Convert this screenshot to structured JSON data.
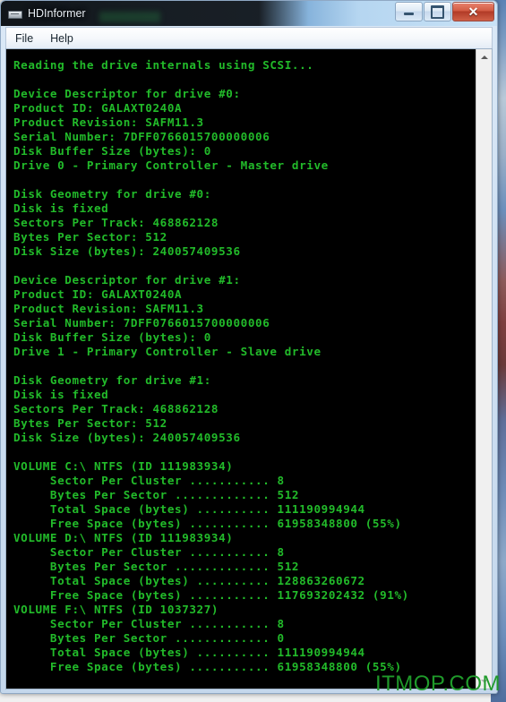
{
  "window": {
    "title": "HDInformer",
    "icon": "chip-icon",
    "controls": {
      "minimize_label": "–",
      "maximize_label": "□",
      "close_label": "✕",
      "minimize_name": "minimize",
      "maximize_name": "maximize",
      "close_name": "close"
    }
  },
  "menubar": {
    "items": [
      {
        "label": "File"
      },
      {
        "label": "Help"
      }
    ]
  },
  "scrollbar": {
    "up_arrow": "▲",
    "down_arrow": "▼"
  },
  "watermark": {
    "text": "ITMOP.COM",
    "color": "#1f9a2a"
  },
  "console": {
    "text_color": "#22bb2a",
    "background_color": "#000000",
    "content": "Reading the drive internals using SCSI...\n\nDevice Descriptor for drive #0:\nProduct ID: GALAXT0240A\nProduct Revision: SAFM11.3\nSerial Number: 7DFF0766015700000006\nDisk Buffer Size (bytes): 0\nDrive 0 - Primary Controller - Master drive\n\nDisk Geometry for drive #0:\nDisk is fixed\nSectors Per Track: 468862128\nBytes Per Sector: 512\nDisk Size (bytes): 240057409536\n\nDevice Descriptor for drive #1:\nProduct ID: GALAXT0240A\nProduct Revision: SAFM11.3\nSerial Number: 7DFF0766015700000006\nDisk Buffer Size (bytes): 0\nDrive 1 - Primary Controller - Slave drive\n\nDisk Geometry for drive #1:\nDisk is fixed\nSectors Per Track: 468862128\nBytes Per Sector: 512\nDisk Size (bytes): 240057409536\n\nVOLUME C:\\ NTFS (ID 111983934)\n     Sector Per Cluster ........... 8\n     Bytes Per Sector ............. 512\n     Total Space (bytes) .......... 111190994944\n     Free Space (bytes) ........... 61958348800 (55%)\nVOLUME D:\\ NTFS (ID 111983934)\n     Sector Per Cluster ........... 8\n     Bytes Per Sector ............. 512\n     Total Space (bytes) .......... 128863260672\n     Free Space (bytes) ........... 117693202432 (91%)\nVOLUME F:\\ NTFS (ID 1037327)\n     Sector Per Cluster ........... 8\n     Bytes Per Sector ............. 0\n     Total Space (bytes) .......... 111190994944\n     Free Space (bytes) ........... 61958348800 (55%)",
    "report": {
      "intro_line": "Reading the drive internals using SCSI...",
      "drives": [
        {
          "descriptor_header": "Device Descriptor for drive #0:",
          "product_id_label": "Product ID:",
          "product_id": "GALAXT0240A",
          "product_revision_label": "Product Revision:",
          "product_revision": "SAFM11.3",
          "serial_number_label": "Serial Number:",
          "serial_number": "7DFF0766015700000006",
          "disk_buffer_label": "Disk Buffer Size (bytes):",
          "disk_buffer": "0",
          "controller_line": "Drive 0 - Primary Controller - Master drive",
          "geometry_header": "Disk Geometry for drive #0:",
          "fixed_line": "Disk is fixed",
          "sectors_per_track_label": "Sectors Per Track:",
          "sectors_per_track": "468862128",
          "bytes_per_sector_label": "Bytes Per Sector:",
          "bytes_per_sector": "512",
          "disk_size_label": "Disk Size (bytes):",
          "disk_size": "240057409536"
        },
        {
          "descriptor_header": "Device Descriptor for drive #1:",
          "product_id_label": "Product ID:",
          "product_id": "GALAXT0240A",
          "product_revision_label": "Product Revision:",
          "product_revision": "SAFM11.3",
          "serial_number_label": "Serial Number:",
          "serial_number": "7DFF0766015700000006",
          "disk_buffer_label": "Disk Buffer Size (bytes):",
          "disk_buffer": "0",
          "controller_line": "Drive 1 - Primary Controller - Slave drive",
          "geometry_header": "Disk Geometry for drive #1:",
          "fixed_line": "Disk is fixed",
          "sectors_per_track_label": "Sectors Per Track:",
          "sectors_per_track": "468862128",
          "bytes_per_sector_label": "Bytes Per Sector:",
          "bytes_per_sector": "512",
          "disk_size_label": "Disk Size (bytes):",
          "disk_size": "240057409536"
        }
      ],
      "volumes": [
        {
          "header": "VOLUME C:\\ NTFS (ID 111983934)",
          "drive_letter": "C:\\",
          "filesystem": "NTFS",
          "id": "111983934",
          "sector_per_cluster_label": "Sector Per Cluster",
          "sector_per_cluster": "8",
          "bytes_per_sector_label": "Bytes Per Sector",
          "bytes_per_sector": "512",
          "total_space_label": "Total Space (bytes)",
          "total_space": "111190994944",
          "free_space_label": "Free Space (bytes)",
          "free_space": "61958348800",
          "free_percent": "(55%)"
        },
        {
          "header": "VOLUME D:\\ NTFS (ID 111983934)",
          "drive_letter": "D:\\",
          "filesystem": "NTFS",
          "id": "111983934",
          "sector_per_cluster_label": "Sector Per Cluster",
          "sector_per_cluster": "8",
          "bytes_per_sector_label": "Bytes Per Sector",
          "bytes_per_sector": "512",
          "total_space_label": "Total Space (bytes)",
          "total_space": "128863260672",
          "free_space_label": "Free Space (bytes)",
          "free_space": "117693202432",
          "free_percent": "(91%)"
        },
        {
          "header": "VOLUME F:\\ NTFS (ID 1037327)",
          "drive_letter": "F:\\",
          "filesystem": "NTFS",
          "id": "1037327",
          "sector_per_cluster_label": "Sector Per Cluster",
          "sector_per_cluster": "8",
          "bytes_per_sector_label": "Bytes Per Sector",
          "bytes_per_sector": "0",
          "total_space_label": "Total Space (bytes)",
          "total_space": "111190994944",
          "free_space_label": "Free Space (bytes)",
          "free_space": "61958348800",
          "free_percent": "(55%)"
        }
      ]
    }
  }
}
